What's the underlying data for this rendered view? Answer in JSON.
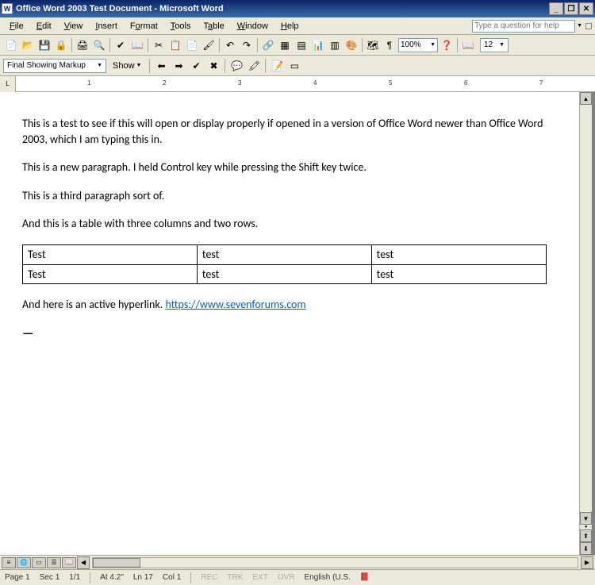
{
  "titlebar": {
    "title": "Office Word 2003 Test Document - Microsoft Word",
    "icon": "W"
  },
  "menubar": {
    "items": [
      {
        "label": "File",
        "u": "F"
      },
      {
        "label": "Edit",
        "u": "E"
      },
      {
        "label": "View",
        "u": "V"
      },
      {
        "label": "Insert",
        "u": "I"
      },
      {
        "label": "Format",
        "u": "o"
      },
      {
        "label": "Tools",
        "u": "T"
      },
      {
        "label": "Table",
        "u": "a"
      },
      {
        "label": "Window",
        "u": "W"
      },
      {
        "label": "Help",
        "u": "H"
      }
    ],
    "help_placeholder": "Type a question for help"
  },
  "toolbar1": {
    "zoom": "100%",
    "fontsize": "12"
  },
  "toolbar2": {
    "markup": "Final Showing Markup",
    "show": "Show"
  },
  "document": {
    "p1": "This is a test to see if this will open or display properly if opened in a version of Office Word newer than Office Word 2003, which I am typing this in.",
    "p2": "This is a new paragraph. I held Control key while pressing the Shift key twice.",
    "p3": "This is a third paragraph sort of.",
    "p4": "And this is a table with three columns and two rows.",
    "table": [
      [
        "Test",
        "test",
        "test"
      ],
      [
        "Test",
        "test",
        "test"
      ]
    ],
    "p5_pre": "And here is an active hyperlink. ",
    "p5_link": "https://www.sevenforums.com",
    "cursor": "—"
  },
  "ruler": {
    "ticks": [
      "1",
      "2",
      "3",
      "4",
      "5",
      "6",
      "7"
    ]
  },
  "status": {
    "page": "Page 1",
    "sec": "Sec 1",
    "pages": "1/1",
    "at": "At 4.2\"",
    "ln": "Ln 17",
    "col": "Col 1",
    "rec": "REC",
    "trk": "TRK",
    "ext": "EXT",
    "ovr": "OVR",
    "lang": "English (U.S."
  }
}
